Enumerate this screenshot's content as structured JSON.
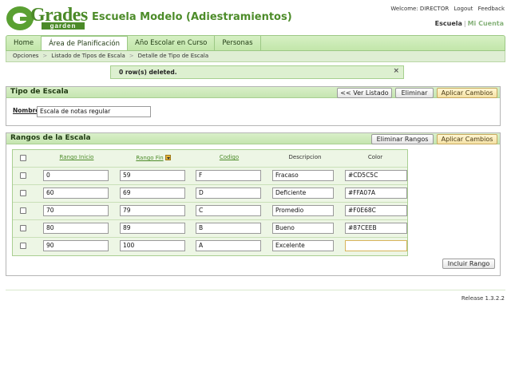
{
  "header": {
    "logo_text": "Grades",
    "logo_sub": "garden",
    "app_title": "Escuela Modelo (Adiestramientos)",
    "welcome": "Welcome: DIRECTOR",
    "logout": "Logout",
    "feedback": "Feedback",
    "account_active": "Escuela",
    "account_other": "Mi Cuenta"
  },
  "nav": {
    "tabs": [
      {
        "label": "Home"
      },
      {
        "label": "Área de Planificación"
      },
      {
        "label": "Año Escolar en Curso"
      },
      {
        "label": "Personas"
      }
    ]
  },
  "breadcrumb": [
    "Opciones",
    "Listado de Tipos de Escala",
    "Detalle de Tipo de Escala"
  ],
  "message": {
    "text": "0 row(s) deleted.",
    "close": "×"
  },
  "scale_panel": {
    "title": "Tipo de Escala",
    "back_label": "<< Ver Listado",
    "delete_label": "Eliminar",
    "apply_label": "Aplicar Cambios",
    "name_label": "Nombre",
    "name_value": "Escala de notas regular"
  },
  "ranges_panel": {
    "title": "Rangos de la Escala",
    "delete_label": "Eliminar Rangos",
    "apply_label": "Aplicar Cambios",
    "add_label": "Incluir Rango",
    "columns": [
      "Rango Inicio",
      "Rango Fin",
      "Codigo",
      "Descripcion",
      "Color"
    ],
    "rows": [
      {
        "start": "0",
        "end": "59",
        "code": "F",
        "desc": "Fracaso",
        "color": "#CD5C5C"
      },
      {
        "start": "60",
        "end": "69",
        "code": "D",
        "desc": "Deficiente",
        "color": "#FFA07A"
      },
      {
        "start": "70",
        "end": "79",
        "code": "C",
        "desc": "Promedio",
        "color": "#F0E68C"
      },
      {
        "start": "80",
        "end": "89",
        "code": "B",
        "desc": "Bueno",
        "color": "#87CEEB"
      },
      {
        "start": "90",
        "end": "100",
        "code": "A",
        "desc": "Excelente",
        "color": ""
      }
    ]
  },
  "release": "Release 1.3.2.2"
}
